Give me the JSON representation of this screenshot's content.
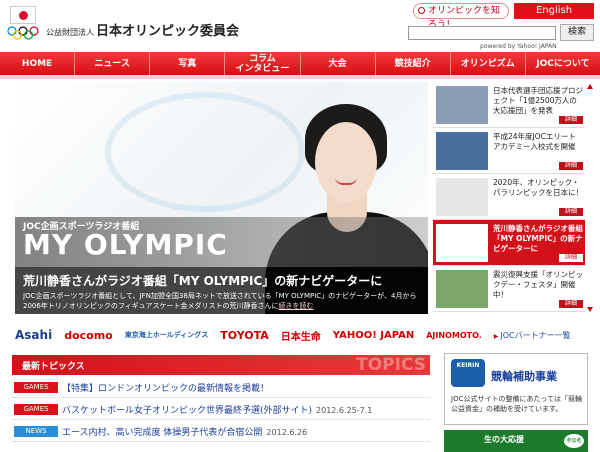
{
  "header": {
    "org_prefix": "公益財団法人",
    "org_name": "日本オリンピック委員会",
    "know_link": "オリンピックを知ろう！",
    "english_link": "English",
    "search_button": "検索",
    "powered_by": "powered by Yahoo! JAPAN"
  },
  "nav": {
    "items": [
      "HOME",
      "ニュース",
      "写真",
      "コラム\nインタビュー",
      "大会",
      "競技紹介",
      "オリンピズム",
      "JOCについて"
    ]
  },
  "hero": {
    "tagline": "JOC企画スポーツラジオ番組",
    "program": "MY OLYMPIC",
    "headline": "荒川静香さんがラジオ番組「MY OLYMPIC」の新ナビゲーターに",
    "description": "JOC企画スポーツラジオ番組として、JFN加盟全国38局ネットで放送されている「MY OLYMPIC」のナビゲーターが、4月から2006年トリノオリンピックのフィギュアスケート金メダリストの荒川静香さんに",
    "more": "続きを読む"
  },
  "side": {
    "items": [
      {
        "text": "日本代表選手団応援プロジェクト「1億2500万人の大応援団」を発表",
        "detail": "詳細",
        "active": false
      },
      {
        "text": "平成24年度JOCエリートアカデミー入校式を開催",
        "detail": "詳細",
        "active": false
      },
      {
        "text": "2020年、オリンピック・パラリンピックを日本に！",
        "detail": "詳細",
        "active": false
      },
      {
        "text": "荒川静香さんがラジオ番組「MY OLYMPIC」の新ナビゲーターに",
        "detail": "詳細",
        "active": true
      },
      {
        "text": "震災復興支援「オリンピックデー・フェスタ」開催中！",
        "detail": "詳細",
        "active": false
      }
    ]
  },
  "sponsors": {
    "names": [
      "Asahi",
      "docomo",
      "東京海上ホールディングス",
      "TOYOTA",
      "日本生命",
      "YAHOO! JAPAN",
      "AJINOMOTO."
    ],
    "partner_link": "JOCパートナー一覧"
  },
  "topics": {
    "heading": "最新トピックス",
    "heading_en": "TOPICS",
    "items": [
      {
        "badge": "GAMES",
        "title": "【特集】ロンドンオリンピックの最新情報を掲載！",
        "date": ""
      },
      {
        "badge": "GAMES",
        "title": "バスケットボール女子オリンピック世界最終予選(外部サイト)",
        "date": "2012.6.25-7.1"
      },
      {
        "badge": "NEWS",
        "title": "エース内村、高い完成度 体操男子代表が合宿公開",
        "date": "2012.6.26"
      }
    ]
  },
  "keirin": {
    "logo_text": "KEIRIN",
    "title": "競輪補助事業",
    "note": "JOC公式サイトの整備にあたっては「競輪公益資金」の補助を受けています。"
  },
  "lottery": {
    "text": "生の大応援",
    "badge": "参加者"
  },
  "colors": {
    "brand_red": "#d3111b",
    "link_blue": "#1a3f9a",
    "news_blue": "#2a8fd8"
  }
}
